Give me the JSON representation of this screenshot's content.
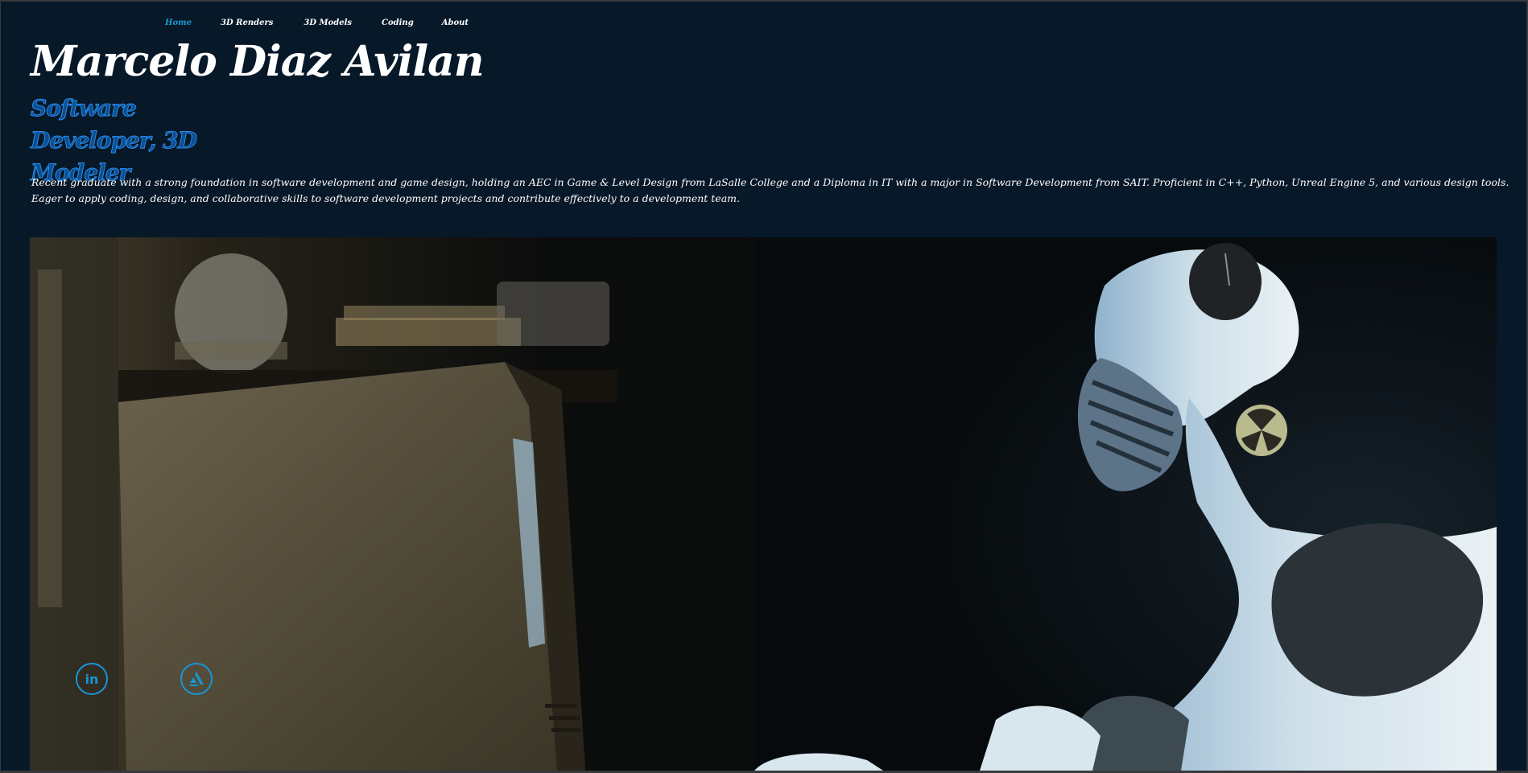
{
  "nav": {
    "items": [
      {
        "label": "Home",
        "active": true
      },
      {
        "label": "3D Renders",
        "active": false
      },
      {
        "label": "3D Models",
        "active": false
      },
      {
        "label": "Coding",
        "active": false
      },
      {
        "label": "About",
        "active": false
      }
    ]
  },
  "hero": {
    "name": "Marcelo Diaz Avilan",
    "role": "Software Developer, 3D Modeler",
    "bio": "Recent graduate with a strong foundation in software development and game design, holding an AEC in Game & Level Design from LaSalle College and a Diploma in IT with a major in Software Development from SAIT. Proficient in C++, Python, Unreal Engine 5, and various design tools. Eager to apply coding, design, and collaborative skills to software development projects and contribute effectively to a development team."
  },
  "social": {
    "linkedin_glyph": "in",
    "links": [
      {
        "icon": "linkedin-icon"
      },
      {
        "icon": "artstation-icon"
      }
    ]
  },
  "colors": {
    "background": "#071828",
    "accent": "#1e9bd7",
    "subtitle": "#2a8ae6",
    "text": "#ffffff"
  }
}
